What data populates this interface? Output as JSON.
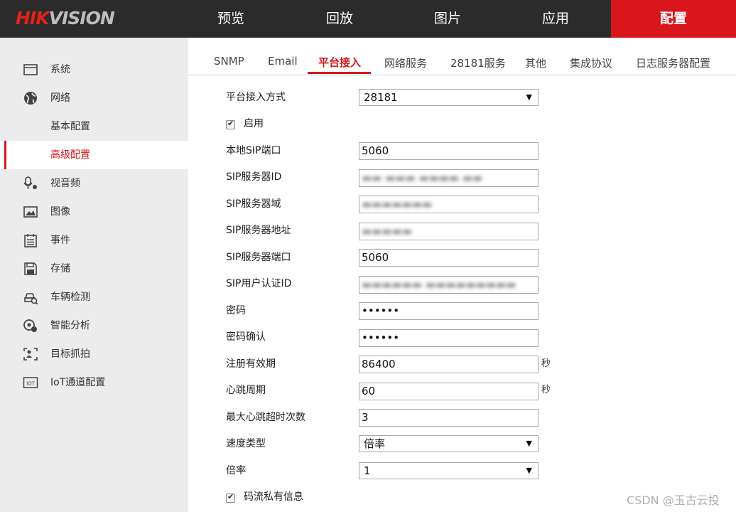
{
  "brand": {
    "logo_part1": "HIK",
    "logo_part2": "VISION"
  },
  "topnav": [
    "预览",
    "回放",
    "图片",
    "应用",
    "配置"
  ],
  "sidebar": [
    {
      "label": "系统",
      "icon": "system-icon"
    },
    {
      "label": "网络",
      "icon": "network-globe-icon"
    },
    {
      "label": "基本配置",
      "icon": ""
    },
    {
      "label": "高级配置",
      "icon": ""
    },
    {
      "label": "视音频",
      "icon": "video-audio-icon"
    },
    {
      "label": "图像",
      "icon": "image-icon"
    },
    {
      "label": "事件",
      "icon": "event-icon"
    },
    {
      "label": "存储",
      "icon": "storage-icon"
    },
    {
      "label": "车辆检测",
      "icon": "vehicle-detection-icon"
    },
    {
      "label": "智能分析",
      "icon": "smart-analysis-icon"
    },
    {
      "label": "目标抓拍",
      "icon": "target-capture-icon"
    },
    {
      "label": "IoT通道配置",
      "icon": "iot-icon"
    }
  ],
  "tabs": [
    "SNMP",
    "Email",
    "平台接入",
    "网络服务",
    "28181服务",
    "其他",
    "集成协议",
    "日志服务器配置"
  ],
  "form": {
    "access_mode_label": "平台接入方式",
    "access_mode_value": "28181",
    "enable_label": "启用",
    "local_sip_port_label": "本地SIP端口",
    "local_sip_port_value": "5060",
    "sip_server_id_label": "SIP服务器ID",
    "sip_server_id_value": "",
    "sip_server_domain_label": "SIP服务器域",
    "sip_server_domain_value": "",
    "sip_server_addr_label": "SIP服务器地址",
    "sip_server_addr_value": "",
    "sip_server_port_label": "SIP服务器端口",
    "sip_server_port_value": "5060",
    "sip_auth_id_label": "SIP用户认证ID",
    "sip_auth_id_value": "",
    "password_label": "密码",
    "password_value": "••••••",
    "password_confirm_label": "密码确认",
    "password_confirm_value": "••••••",
    "register_validity_label": "注册有效期",
    "register_validity_value": "86400",
    "heartbeat_label": "心跳周期",
    "heartbeat_value": "60",
    "max_heartbeat_timeout_label": "最大心跳超时次数",
    "max_heartbeat_timeout_value": "3",
    "speed_type_label": "速度类型",
    "speed_type_value": "倍率",
    "rate_label": "倍率",
    "rate_value": "1",
    "stream_private_label": "码流私有信息",
    "unit_seconds": "秒"
  },
  "watermark": "CSDN @玉古云投",
  "colors": {
    "accent": "#d8161c",
    "topbar": "#2b2b2b",
    "sidebar_bg": "#ececec"
  }
}
